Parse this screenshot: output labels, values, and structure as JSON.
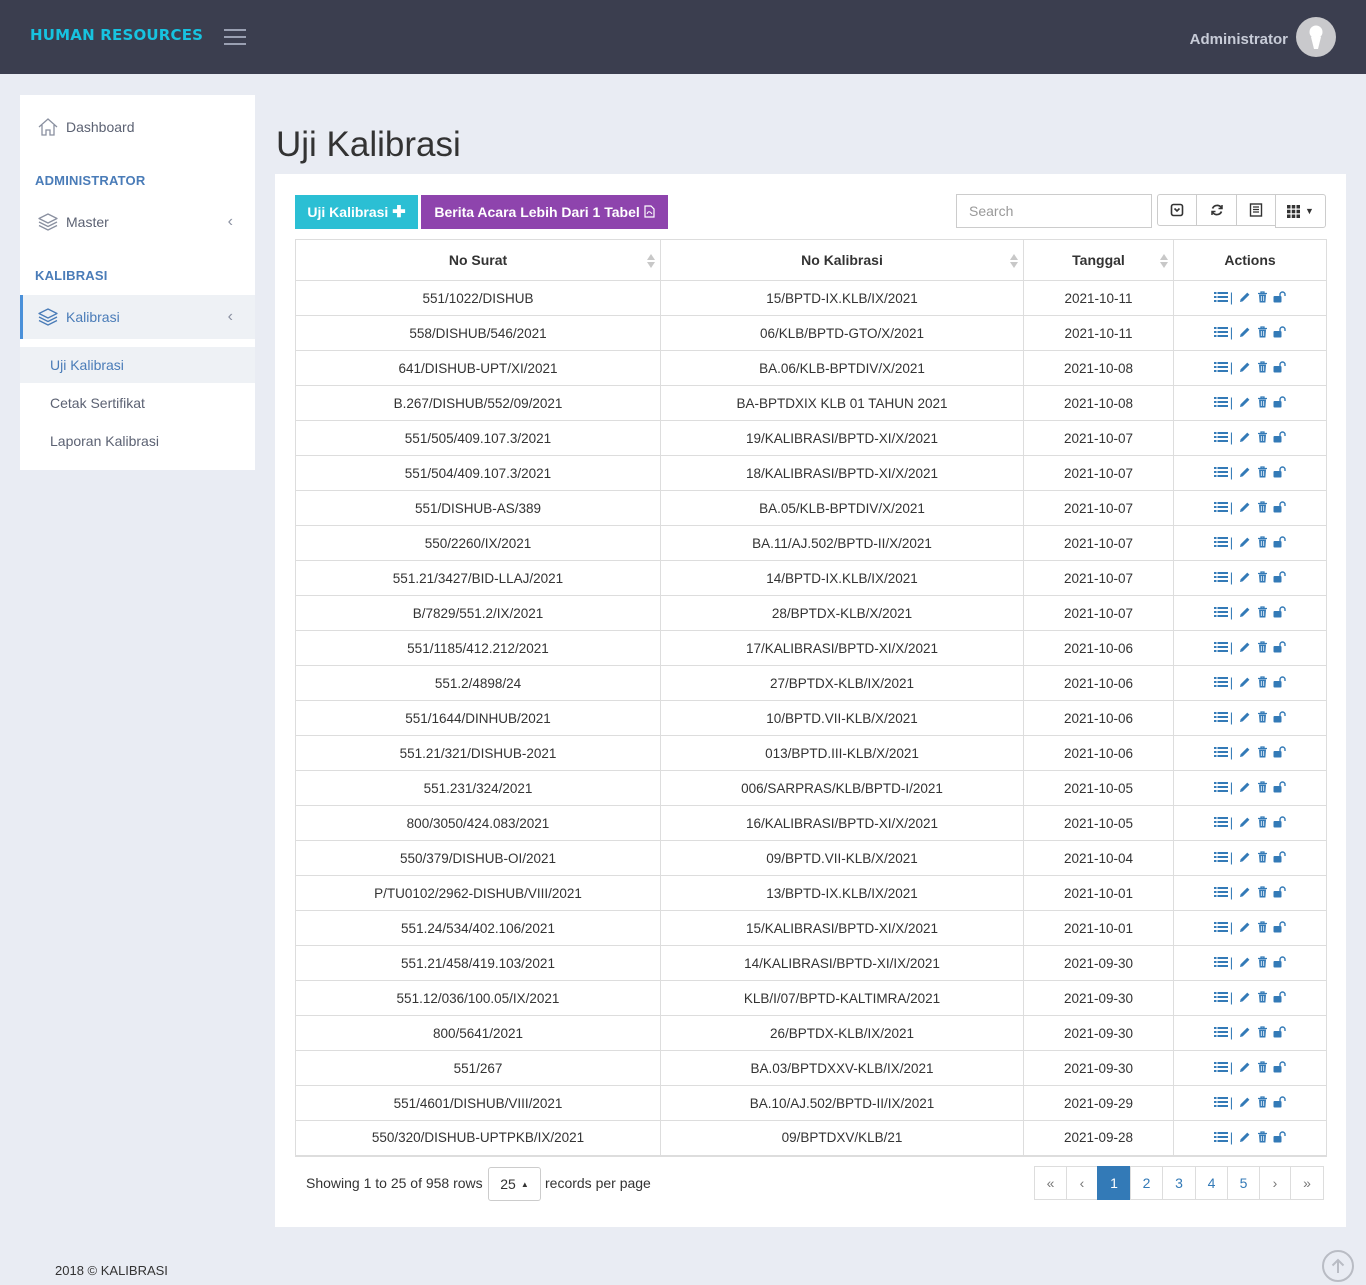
{
  "header": {
    "brand": "HUMAN RESOURCES",
    "user_name": "Administrator"
  },
  "sidebar": {
    "dashboard": "Dashboard",
    "section_admin": "ADMINISTRATOR",
    "master": "Master",
    "section_kalibrasi": "KALIBRASI",
    "kalibrasi": "Kalibrasi",
    "sub_items": [
      "Uji Kalibrasi",
      "Cetak Sertifikat",
      "Laporan Kalibrasi"
    ]
  },
  "page": {
    "title": "Uji Kalibrasi"
  },
  "toolbar": {
    "add_label": "Uji Kalibrasi",
    "ba_label": "Berita Acara Lebih Dari 1 Tabel",
    "search_placeholder": "Search"
  },
  "table": {
    "headers": [
      "No Surat",
      "No Kalibrasi",
      "Tanggal",
      "Actions"
    ],
    "rows": [
      [
        "551/1022/DISHUB",
        "15/BPTD-IX.KLB/IX/2021",
        "2021-10-11"
      ],
      [
        "558/DISHUB/546/2021",
        "06/KLB/BPTD-GTO/X/2021",
        "2021-10-11"
      ],
      [
        "641/DISHUB-UPT/XI/2021",
        "BA.06/KLB-BPTDIV/X/2021",
        "2021-10-08"
      ],
      [
        "B.267/DISHUB/552/09/2021",
        "BA-BPTDXIX KLB 01 TAHUN 2021",
        "2021-10-08"
      ],
      [
        "551/505/409.107.3/2021",
        "19/KALIBRASI/BPTD-XI/X/2021",
        "2021-10-07"
      ],
      [
        "551/504/409.107.3/2021",
        "18/KALIBRASI/BPTD-XI/X/2021",
        "2021-10-07"
      ],
      [
        "551/DISHUB-AS/389",
        "BA.05/KLB-BPTDIV/X/2021",
        "2021-10-07"
      ],
      [
        "550/2260/IX/2021",
        "BA.11/AJ.502/BPTD-II/X/2021",
        "2021-10-07"
      ],
      [
        "551.21/3427/BID-LLAJ/2021",
        "14/BPTD-IX.KLB/IX/2021",
        "2021-10-07"
      ],
      [
        "B/7829/551.2/IX/2021",
        "28/BPTDX-KLB/X/2021",
        "2021-10-07"
      ],
      [
        "551/1185/412.212/2021",
        "17/KALIBRASI/BPTD-XI/X/2021",
        "2021-10-06"
      ],
      [
        "551.2/4898/24",
        "27/BPTDX-KLB/IX/2021",
        "2021-10-06"
      ],
      [
        "551/1644/DINHUB/2021",
        "10/BPTD.VII-KLB/X/2021",
        "2021-10-06"
      ],
      [
        "551.21/321/DISHUB-2021",
        "013/BPTD.III-KLB/X/2021",
        "2021-10-06"
      ],
      [
        "551.231/324/2021",
        "006/SARPRAS/KLB/BPTD-I/2021",
        "2021-10-05"
      ],
      [
        "800/3050/424.083/2021",
        "16/KALIBRASI/BPTD-XI/X/2021",
        "2021-10-05"
      ],
      [
        "550/379/DISHUB-OI/2021",
        "09/BPTD.VII-KLB/X/2021",
        "2021-10-04"
      ],
      [
        "P/TU0102/2962-DISHUB/VIII/2021",
        "13/BPTD-IX.KLB/IX/2021",
        "2021-10-01"
      ],
      [
        "551.24/534/402.106/2021",
        "15/KALIBRASI/BPTD-XI/X/2021",
        "2021-10-01"
      ],
      [
        "551.21/458/419.103/2021",
        "14/KALIBRASI/BPTD-XI/IX/2021",
        "2021-09-30"
      ],
      [
        "551.12/036/100.05/IX/2021",
        "KLB/I/07/BPTD-KALTIMRA/2021",
        "2021-09-30"
      ],
      [
        "800/5641/2021",
        "26/BPTDX-KLB/IX/2021",
        "2021-09-30"
      ],
      [
        "551/267",
        "BA.03/BPTDXXV-KLB/IX/2021",
        "2021-09-30"
      ],
      [
        "551/4601/DISHUB/VIII/2021",
        "BA.10/AJ.502/BPTD-II/IX/2021",
        "2021-09-29"
      ],
      [
        "550/320/DISHUB-UPTPKB/IX/2021",
        "09/BPTDXV/KLB/21",
        "2021-09-28"
      ]
    ],
    "action_icons": [
      "list-icon",
      "pencil-icon",
      "trash-icon",
      "unlock-icon"
    ]
  },
  "pagination": {
    "showing": "Showing 1 to 25 of 958 rows",
    "page_size": "25",
    "per_page_label": "records per page",
    "pages": [
      "«",
      "‹",
      "1",
      "2",
      "3",
      "4",
      "5",
      "›",
      "»"
    ],
    "current_page": "1"
  },
  "footer": {
    "text": "2018 © KALIBRASI"
  },
  "colors": {
    "topbar": "#3b3e4f",
    "brand": "#17c3e0",
    "add_button": "#2bbfd4",
    "ba_button": "#8e44ad",
    "accent": "#337ab7"
  }
}
